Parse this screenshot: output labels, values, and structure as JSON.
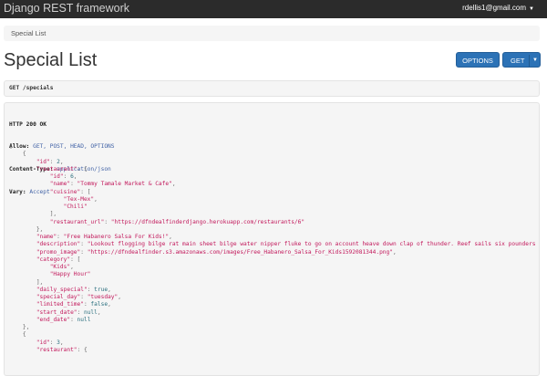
{
  "navbar": {
    "brand": "Django REST framework",
    "user": "rdellis1@gmail.com"
  },
  "breadcrumb": {
    "items": [
      "Special List"
    ]
  },
  "page": {
    "title": "Special List",
    "options_button": "OPTIONS",
    "get_button": "GET"
  },
  "request": {
    "line": "GET /specials"
  },
  "response": {
    "status": "HTTP 200 OK",
    "headers": [
      {
        "name": "Allow:",
        "value": "GET, POST, HEAD, OPTIONS"
      },
      {
        "name": "Content-Type:",
        "value": "application/json"
      },
      {
        "name": "Vary:",
        "value": "Accept"
      }
    ],
    "json_lines": [
      {
        "indent": 0,
        "parts": [
          {
            "t": "p",
            "v": "["
          }
        ]
      },
      {
        "indent": 1,
        "parts": [
          {
            "t": "p",
            "v": "{"
          }
        ]
      },
      {
        "indent": 2,
        "parts": [
          {
            "t": "k",
            "v": "\"id\""
          },
          {
            "t": "p",
            "v": ": "
          },
          {
            "t": "n",
            "v": "2"
          },
          {
            "t": "p",
            "v": ","
          }
        ]
      },
      {
        "indent": 2,
        "parts": [
          {
            "t": "k",
            "v": "\"restaurant\""
          },
          {
            "t": "p",
            "v": ": {"
          }
        ]
      },
      {
        "indent": 3,
        "parts": [
          {
            "t": "k",
            "v": "\"id\""
          },
          {
            "t": "p",
            "v": ": "
          },
          {
            "t": "n",
            "v": "6"
          },
          {
            "t": "p",
            "v": ","
          }
        ]
      },
      {
        "indent": 3,
        "parts": [
          {
            "t": "k",
            "v": "\"name\""
          },
          {
            "t": "p",
            "v": ": "
          },
          {
            "t": "s",
            "v": "\"Tommy Tamale Market & Cafe\""
          },
          {
            "t": "p",
            "v": ","
          }
        ]
      },
      {
        "indent": 3,
        "parts": [
          {
            "t": "k",
            "v": "\"cuisine\""
          },
          {
            "t": "p",
            "v": ": ["
          }
        ]
      },
      {
        "indent": 4,
        "parts": [
          {
            "t": "s",
            "v": "\"Tex-Mex\""
          },
          {
            "t": "p",
            "v": ","
          }
        ]
      },
      {
        "indent": 4,
        "parts": [
          {
            "t": "s",
            "v": "\"Chili\""
          }
        ]
      },
      {
        "indent": 3,
        "parts": [
          {
            "t": "p",
            "v": "],"
          }
        ]
      },
      {
        "indent": 3,
        "parts": [
          {
            "t": "k",
            "v": "\"restaurant_url\""
          },
          {
            "t": "p",
            "v": ": "
          },
          {
            "t": "s",
            "v": "\"https://dfndealfinderdjango.herokuapp.com/restaurants/6\""
          }
        ]
      },
      {
        "indent": 2,
        "parts": [
          {
            "t": "p",
            "v": "},"
          }
        ]
      },
      {
        "indent": 2,
        "parts": [
          {
            "t": "k",
            "v": "\"name\""
          },
          {
            "t": "p",
            "v": ": "
          },
          {
            "t": "s",
            "v": "\"Free Habanero Salsa For Kids!\""
          },
          {
            "t": "p",
            "v": ","
          }
        ]
      },
      {
        "indent": 2,
        "parts": [
          {
            "t": "k",
            "v": "\"description\""
          },
          {
            "t": "p",
            "v": ": "
          },
          {
            "t": "s",
            "v": "\"Lookout flogging bilge rat main sheet bilge water nipper fluke to go on account heave down clap of thunder. Reef sails six pounders s"
          }
        ]
      },
      {
        "indent": 2,
        "parts": [
          {
            "t": "k",
            "v": "\"promo_image\""
          },
          {
            "t": "p",
            "v": ": "
          },
          {
            "t": "s",
            "v": "\"https://dfndealfinder.s3.amazonaws.com/images/Free_Habanero_Salsa_For_Kids1592081344.png\""
          },
          {
            "t": "p",
            "v": ","
          }
        ]
      },
      {
        "indent": 2,
        "parts": [
          {
            "t": "k",
            "v": "\"category\""
          },
          {
            "t": "p",
            "v": ": ["
          }
        ]
      },
      {
        "indent": 3,
        "parts": [
          {
            "t": "s",
            "v": "\"Kids\""
          },
          {
            "t": "p",
            "v": ","
          }
        ]
      },
      {
        "indent": 3,
        "parts": [
          {
            "t": "s",
            "v": "\"Happy Hour\""
          }
        ]
      },
      {
        "indent": 2,
        "parts": [
          {
            "t": "p",
            "v": "],"
          }
        ]
      },
      {
        "indent": 2,
        "parts": [
          {
            "t": "k",
            "v": "\"daily_special\""
          },
          {
            "t": "p",
            "v": ": "
          },
          {
            "t": "kw",
            "v": "true"
          },
          {
            "t": "p",
            "v": ","
          }
        ]
      },
      {
        "indent": 2,
        "parts": [
          {
            "t": "k",
            "v": "\"special_day\""
          },
          {
            "t": "p",
            "v": ": "
          },
          {
            "t": "s",
            "v": "\"tuesday\""
          },
          {
            "t": "p",
            "v": ","
          }
        ]
      },
      {
        "indent": 2,
        "parts": [
          {
            "t": "k",
            "v": "\"limited_time\""
          },
          {
            "t": "p",
            "v": ": "
          },
          {
            "t": "kw",
            "v": "false"
          },
          {
            "t": "p",
            "v": ","
          }
        ]
      },
      {
        "indent": 2,
        "parts": [
          {
            "t": "k",
            "v": "\"start_date\""
          },
          {
            "t": "p",
            "v": ": "
          },
          {
            "t": "kw",
            "v": "null"
          },
          {
            "t": "p",
            "v": ","
          }
        ]
      },
      {
        "indent": 2,
        "parts": [
          {
            "t": "k",
            "v": "\"end_date\""
          },
          {
            "t": "p",
            "v": ": "
          },
          {
            "t": "kw",
            "v": "null"
          }
        ]
      },
      {
        "indent": 1,
        "parts": [
          {
            "t": "p",
            "v": "},"
          }
        ]
      },
      {
        "indent": 1,
        "parts": [
          {
            "t": "p",
            "v": "{"
          }
        ]
      },
      {
        "indent": 2,
        "parts": [
          {
            "t": "k",
            "v": "\"id\""
          },
          {
            "t": "p",
            "v": ": "
          },
          {
            "t": "n",
            "v": "3"
          },
          {
            "t": "p",
            "v": ","
          }
        ]
      },
      {
        "indent": 2,
        "parts": [
          {
            "t": "k",
            "v": "\"restaurant\""
          },
          {
            "t": "p",
            "v": ": {"
          }
        ]
      }
    ]
  }
}
